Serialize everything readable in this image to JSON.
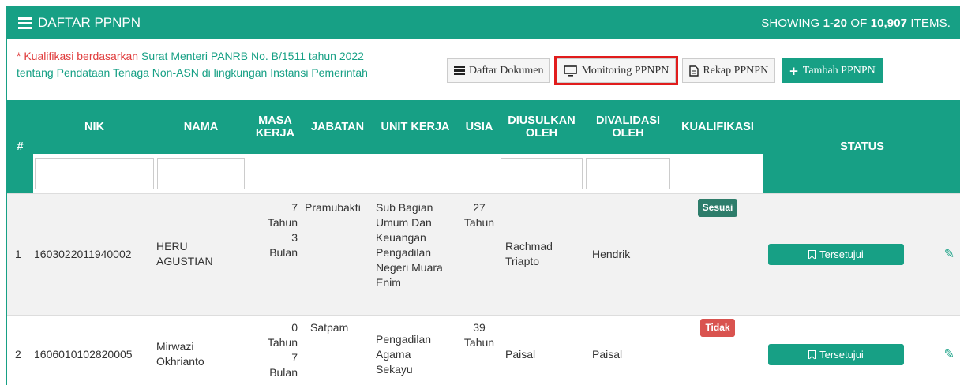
{
  "header": {
    "title": "DAFTAR PPNPN",
    "summary_prefix": "SHOWING",
    "summary_range": "1-20",
    "summary_mid": "OF",
    "summary_total": "10,907",
    "summary_suffix": "ITEMS."
  },
  "note": {
    "asterisk": "* Kualifikasi berdasarkan",
    "line1": "Surat Menteri PANRB No. B/1511 tahun 2022",
    "line2": "tentang Pendataan Tenaga Non-ASN di lingkungan Instansi Pemerintah"
  },
  "toolbar": {
    "daftar_dokumen": "Daftar Dokumen",
    "monitoring": "Monitoring PPNPN",
    "rekap": "Rekap PPNPN",
    "tambah": "Tambah PPNPN"
  },
  "columns": {
    "no": "#",
    "nik": "NIK",
    "nama": "NAMA",
    "masa_kerja_1": "MASA",
    "masa_kerja_2": "KERJA",
    "jabatan": "JABATAN",
    "unit_kerja": "UNIT KERJA",
    "usia": "USIA",
    "diusulkan_1": "DIUSULKAN",
    "diusulkan_2": "OLEH",
    "divalidasi_1": "DIVALIDASI",
    "divalidasi_2": "OLEH",
    "kualifikasi": "KUALIFIKASI",
    "status": "STATUS"
  },
  "rows": [
    {
      "no": "1",
      "nik": "1603022011940002",
      "nama_1": "HERU",
      "nama_2": "AGUSTIAN",
      "masa_1": "7",
      "masa_2": "Tahun",
      "masa_3": "3",
      "masa_4": "Bulan",
      "jabatan": "Pramubakti",
      "unit_1": "Sub Bagian",
      "unit_2": "Umum Dan",
      "unit_3": "Keuangan",
      "unit_4": "Pengadilan",
      "unit_5": "Negeri Muara",
      "unit_6": "Enim",
      "usia_1": "27",
      "usia_2": "Tahun",
      "diusulkan_1": "Rachmad",
      "diusulkan_2": "Triapto",
      "divalidasi": "Hendrik",
      "kualifikasi": "Sesuai",
      "status": "Tersetujui"
    },
    {
      "no": "2",
      "nik": "1606010102820005",
      "nama_1": "Mirwazi",
      "nama_2": "Okhrianto",
      "masa_1": "0",
      "masa_2": "Tahun",
      "masa_3": "7",
      "masa_4": "Bulan",
      "jabatan": "Satpam",
      "unit_1": "Pengadilan",
      "unit_2": "Agama",
      "unit_3": "Sekayu",
      "usia_1": "39",
      "usia_2": "Tahun",
      "diusulkan_1": "Paisal",
      "divalidasi": "Paisal",
      "kualifikasi": "Tidak",
      "status": "Tersetujui"
    }
  ],
  "colors": {
    "accent": "#17a085",
    "highlight": "#e11c1c",
    "badge_ok": "#2e7d6b",
    "badge_no": "#d9534f"
  }
}
